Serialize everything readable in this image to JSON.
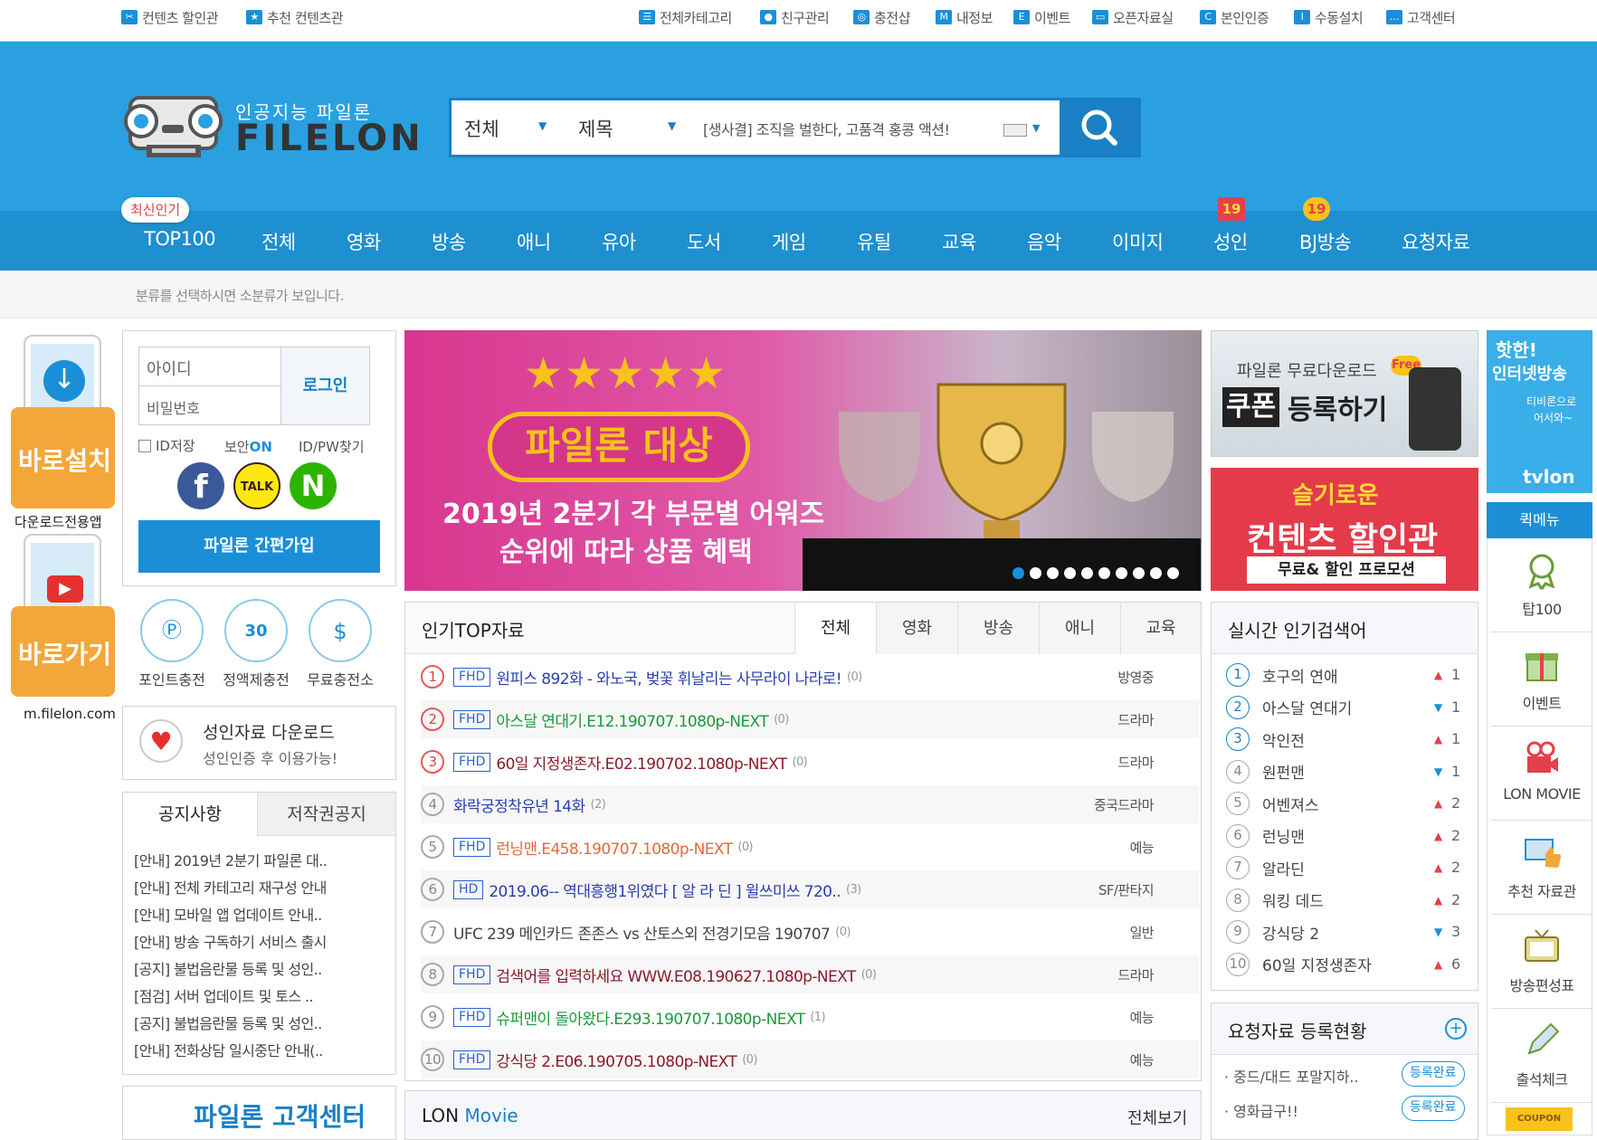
{
  "topbar": {
    "left": [
      "컨텐츠 할인관",
      "추천 컨텐츠관"
    ],
    "right": [
      "전체카테고리",
      "친구관리",
      "충전샵",
      "내정보",
      "이벤트",
      "오픈자료실",
      "본인인증",
      "수동설치",
      "고객센터"
    ]
  },
  "logo": {
    "sub": "인공지능 파일론",
    "main": "FILELON"
  },
  "search": {
    "scope": "전체",
    "field": "제목",
    "placeholder": "[생사결] 조직을 벌한다, 고품격 홍콩 액션!"
  },
  "nav": {
    "badge": "최신인기",
    "items": [
      "TOP100",
      "전체",
      "영화",
      "방송",
      "애니",
      "유아",
      "도서",
      "게임",
      "유틸",
      "교육",
      "음악",
      "이미지",
      "성인",
      "BJ방송",
      "요청자료"
    ],
    "age_badge": "19"
  },
  "subcat_hint": "분류를 선택하시면 소분류가 보입니다.",
  "app": {
    "install": "바로설치",
    "install_sub": "다운로드전용앱",
    "go": "바로가기",
    "mobile": "m.filelon.com"
  },
  "login": {
    "id_placeholder": "아이디",
    "pw_placeholder": "비밀번호",
    "button": "로그인",
    "save_id": "ID저장",
    "security": "보안",
    "security_on": "ON",
    "find": "ID/PW찾기",
    "signup": "파일론 간편가입"
  },
  "charge": [
    "포인트충전",
    "정액제충전",
    "무료충전소"
  ],
  "adult": {
    "title": "성인자료 다운로드",
    "sub": "성인인증 후 이용가능!"
  },
  "notice": {
    "tabs": [
      "공지사항",
      "저작권공지"
    ],
    "items": [
      "[안내] 2019년 2분기 파일론 대..",
      "[안내] 전체 카테고리 재구성 안내",
      "[안내] 모바일 앱 업데이트 안내..",
      "[안내] 방송 구독하기 서비스 출시",
      "[공지] 불법음란물 등록 및 성인..",
      "[점검] 서버 업데이트 및 토스 ..",
      "[공지] 불법음란물 등록 및 성인..",
      "[안내] 전화상담 일시중단 안내(.."
    ]
  },
  "cs_banner": "파일론 고객센터",
  "banner": {
    "stars": "★★★★★",
    "title": "파일론 대상",
    "line1": "2019년 2분기 각 부문별 어워즈",
    "line2": "순위에 따라 상품 혜택",
    "dots": 10
  },
  "side_banners": {
    "coupon_sub": "파일론 무료다운로드",
    "coupon_free": "Free",
    "coupon_a": "쿠폰",
    "coupon_b": "등록하기",
    "discount_top": "슬기로운",
    "discount_title": "컨텐츠 할인관",
    "discount_sub": "무료& 할인 프로모션",
    "tv_a": "핫한!",
    "tv_b": "인터넷방송",
    "tv_c": "티비론으로",
    "tv_d": "어서와~",
    "tv_logo": "tvlon"
  },
  "top": {
    "title": "인기TOP자료",
    "tabs": [
      "전체",
      "영화",
      "방송",
      "애니",
      "교육"
    ],
    "items": [
      {
        "n": "1",
        "q": "FHD",
        "t": "원피스 892화 - 와노국, 벚꽃 휘날리는 사무라이 나라로!",
        "c": "(0)",
        "cat": "방영중",
        "color": "#2a3fb0"
      },
      {
        "n": "2",
        "q": "FHD",
        "t": "아스달 연대기.E12.190707.1080p-NEXT",
        "c": "(0)",
        "cat": "드라마",
        "color": "#1a9a3a"
      },
      {
        "n": "3",
        "q": "FHD",
        "t": "60일 지정생존자.E02.190702.1080p-NEXT",
        "c": "(0)",
        "cat": "드라마",
        "color": "#8a1a2a"
      },
      {
        "n": "4",
        "q": "",
        "t": "화락궁정착유년 14화",
        "c": "(2)",
        "cat": "중국드라마",
        "color": "#2a3fb0"
      },
      {
        "n": "5",
        "q": "FHD",
        "t": "런닝맨.E458.190707.1080p-NEXT",
        "c": "(0)",
        "cat": "예능",
        "color": "#e06a3a"
      },
      {
        "n": "6",
        "q": "HD",
        "t": "2019.06-- 역대흥행1위였다 [ 알 라 딘 ] 윌쓰미쓰 720..",
        "c": "(3)",
        "cat": "SF/판타지",
        "color": "#2a3fb0"
      },
      {
        "n": "7",
        "q": "",
        "t": "UFC 239 메인카드 존존스 vs 산토스외 전경기모음 190707",
        "c": "(0)",
        "cat": "일반",
        "color": "#444444"
      },
      {
        "n": "8",
        "q": "FHD",
        "t": "검색어를 입력하세요 WWW.E08.190627.1080p-NEXT",
        "c": "(0)",
        "cat": "드라마",
        "color": "#8a1a2a"
      },
      {
        "n": "9",
        "q": "FHD",
        "t": "슈퍼맨이 돌아왔다.E293.190707.1080p-NEXT",
        "c": "(1)",
        "cat": "예능",
        "color": "#1a9a3a"
      },
      {
        "n": "10",
        "q": "FHD",
        "t": "강식당 2.E06.190705.1080p-NEXT",
        "c": "(0)",
        "cat": "예능",
        "color": "#8a1a2a"
      }
    ]
  },
  "realtime": {
    "title": "실시간 인기검색어",
    "items": [
      {
        "n": "1",
        "t": "호구의 연애",
        "d": "up",
        "r": "1"
      },
      {
        "n": "2",
        "t": "아스달 연대기",
        "d": "down",
        "r": "1"
      },
      {
        "n": "3",
        "t": "악인전",
        "d": "up",
        "r": "1"
      },
      {
        "n": "4",
        "t": "원펀맨",
        "d": "down",
        "r": "1"
      },
      {
        "n": "5",
        "t": "어벤져스",
        "d": "up",
        "r": "2"
      },
      {
        "n": "6",
        "t": "런닝맨",
        "d": "up",
        "r": "2"
      },
      {
        "n": "7",
        "t": "알라딘",
        "d": "up",
        "r": "2"
      },
      {
        "n": "8",
        "t": "워킹 데드",
        "d": "up",
        "r": "2"
      },
      {
        "n": "9",
        "t": "강식당 2",
        "d": "down",
        "r": "3"
      },
      {
        "n": "10",
        "t": "60일 지정생존자",
        "d": "up",
        "r": "6"
      }
    ]
  },
  "request": {
    "title": "요청자료 등록현황",
    "items": [
      {
        "t": "중드/대드 포말지하..",
        "s": "등록완료"
      },
      {
        "t": "영화급구!!",
        "s": "등록완료"
      }
    ]
  },
  "lon_movie": {
    "title_a": "LON ",
    "title_b": "Movie",
    "more": "전체보기"
  },
  "quickmenu": {
    "title": "퀵메뉴",
    "items": [
      "탑100",
      "이벤트",
      "LON MOVIE",
      "추천 자료관",
      "방송편성표",
      "출석체크"
    ],
    "coupon": "COUPON"
  },
  "colors": {
    "header": "#2aa0e0",
    "nav": "#1e8fcf",
    "accent": "#1a7fc4",
    "rank_red": "#e55555",
    "up": "#e5404a",
    "down": "#1a8fd8"
  }
}
